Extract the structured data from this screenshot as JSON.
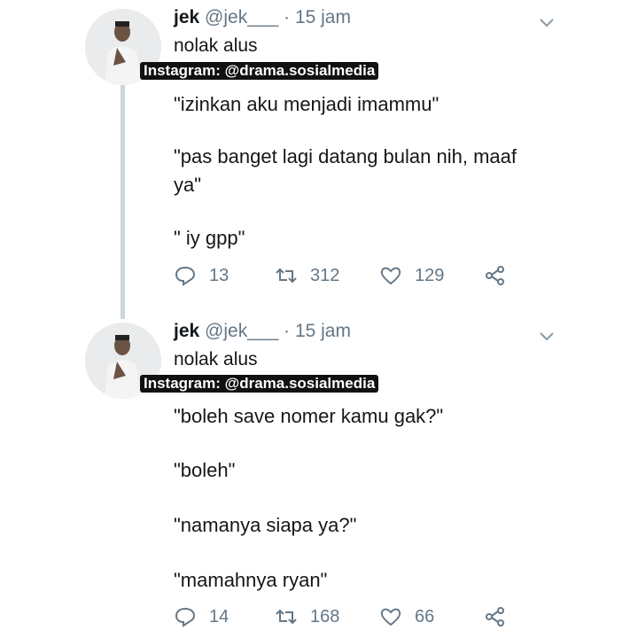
{
  "tweets": [
    {
      "author_name": "jek",
      "handle": "@jek___",
      "separator": "·",
      "time": "15 jam",
      "subtitle": "nolak alus",
      "watermark": "Instagram: @drama.sosialmedia",
      "lines": [
        "\"izinkan aku menjadi imammu\"",
        "\"pas banget lagi datang bulan nih, maaf",
        "ya\"",
        "\" iy gpp\""
      ],
      "replies": "13",
      "retweets": "312",
      "likes": "129"
    },
    {
      "author_name": "jek",
      "handle": "@jek___",
      "separator": "·",
      "time": "15 jam",
      "subtitle": "nolak alus",
      "watermark": "Instagram: @drama.sosialmedia",
      "lines": [
        "\"boleh save nomer kamu gak?\"",
        "\"boleh\"",
        "\"namanya siapa ya?\"",
        "\"mamahnya ryan\""
      ],
      "replies": "14",
      "retweets": "168",
      "likes": "66"
    }
  ],
  "icons": {
    "reply": "reply-icon",
    "retweet": "retweet-icon",
    "like": "heart-icon",
    "share": "share-icon",
    "menu": "chevron-down-icon"
  },
  "colors": {
    "text": "#14171a",
    "muted": "#657786",
    "thread_line": "#ccd6dd"
  }
}
